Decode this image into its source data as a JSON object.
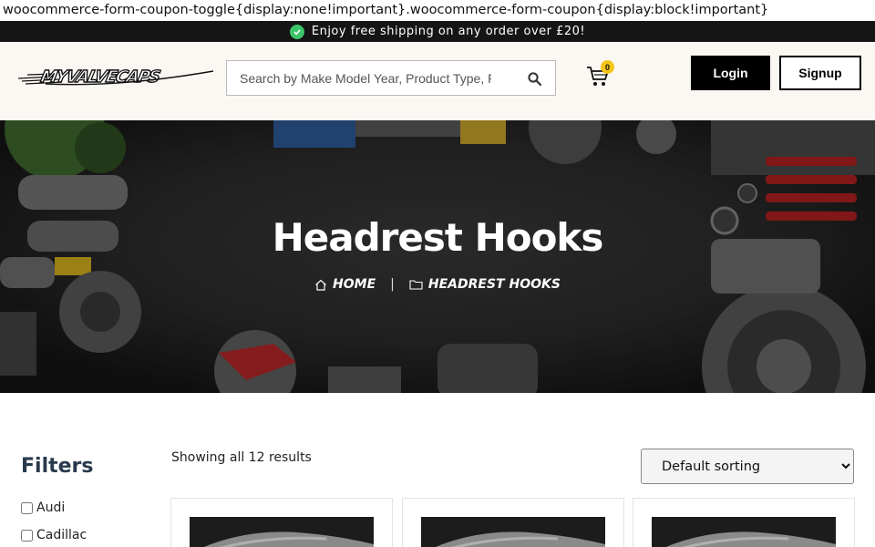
{
  "leaked_css": "woocommerce-form-coupon-toggle{display:none!important}.woocommerce-form-coupon{display:block!important}",
  "promo": {
    "text": "Enjoy free shipping on any order over £20!",
    "icon": "check-circle-icon",
    "color": "#3cc56a"
  },
  "header": {
    "logo_text": "MYVALVECAPS",
    "search": {
      "placeholder": "Search by Make Model Year, Product Type, Part Number",
      "value": ""
    },
    "cart_count": "0",
    "login_label": "Login",
    "signup_label": "Signup"
  },
  "hero": {
    "title": "Headrest Hooks",
    "breadcrumb": {
      "home": "HOME",
      "separator": "|",
      "current": "HEADREST HOOKS"
    }
  },
  "sidebar": {
    "title": "Filters",
    "filters": [
      {
        "label": "Audi",
        "checked": false
      },
      {
        "label": "Cadillac",
        "checked": false
      }
    ]
  },
  "shop": {
    "result_count": "Showing all 12 results",
    "sort": {
      "selected": "Default sorting",
      "options": [
        "Default sorting"
      ]
    }
  },
  "colors": {
    "accent": "#f5c518",
    "dark": "#000000",
    "promo_bg": "#151515",
    "header_bg": "#fbf8f3"
  }
}
